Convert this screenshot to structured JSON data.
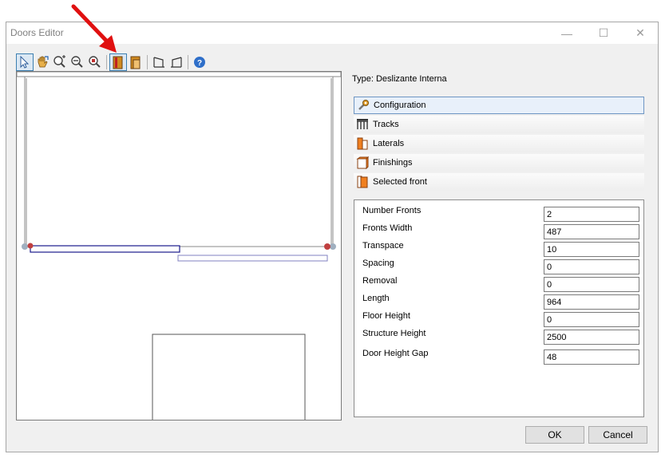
{
  "window": {
    "title": "Doors Editor",
    "controls": {
      "minimize": "—",
      "maximize": "☐",
      "close": "✕"
    }
  },
  "toolbar": {
    "tools": [
      "select-icon",
      "pan-hand-icon",
      "zoom-in-icon",
      "zoom-out-icon",
      "zoom-extents-icon",
      "door-front-icon",
      "door-lateral-icon",
      "open-left-icon",
      "open-right-icon",
      "help-icon"
    ]
  },
  "type_label": "Type: Deslizante Interna",
  "accordion": [
    {
      "label": "Configuration",
      "icon": "wrench-icon"
    },
    {
      "label": "Tracks",
      "icon": "tracks-icon"
    },
    {
      "label": "Laterals",
      "icon": "laterals-icon"
    },
    {
      "label": "Finishings",
      "icon": "finishings-icon"
    },
    {
      "label": "Selected front",
      "icon": "selected-front-icon"
    }
  ],
  "properties": [
    {
      "label": "Number Fronts",
      "value": "2"
    },
    {
      "label": "Fronts Width",
      "value": "487"
    },
    {
      "label": "Transpace",
      "value": "10"
    },
    {
      "label": "Spacing",
      "value": "0"
    },
    {
      "label": "Removal",
      "value": "0"
    },
    {
      "label": "Length",
      "value": "964"
    },
    {
      "label": "Floor Height",
      "value": "0"
    },
    {
      "label": "Structure Height",
      "value": "2500"
    },
    {
      "label": "Door Height Gap",
      "value": "48"
    }
  ],
  "buttons": {
    "ok": "OK",
    "cancel": "Cancel"
  },
  "colors": {
    "accent": "#3c7fb1",
    "arrow": "#e01010",
    "door_outline": "#1a1a8c",
    "door_outline_2": "#8080c0",
    "handle": "#c04040"
  }
}
